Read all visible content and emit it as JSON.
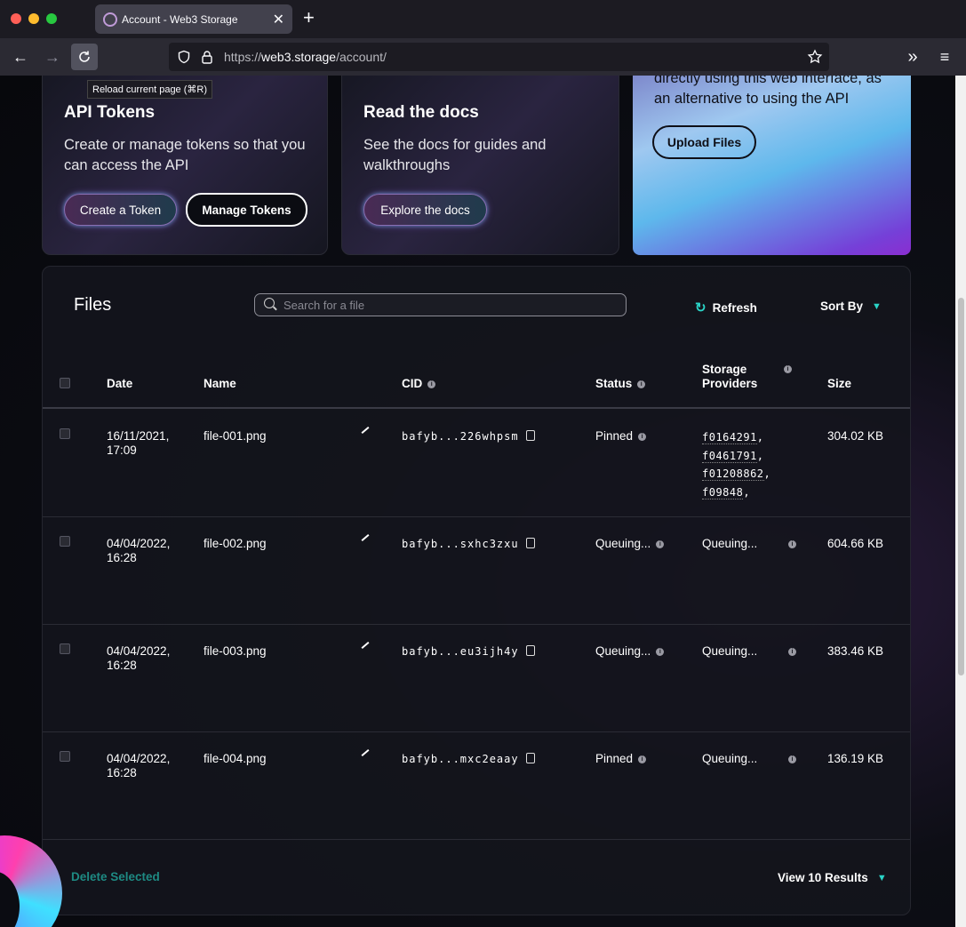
{
  "browser": {
    "tab_title": "Account - Web3 Storage",
    "url_scheme": "https://",
    "url_domain": "web3.storage",
    "url_path": "/account/",
    "reload_tooltip": "Reload current page (⌘R)"
  },
  "cards": {
    "api": {
      "title": "API Tokens",
      "description": "Create or manage tokens so that you can access the API",
      "create_label": "Create a Token",
      "manage_label": "Manage Tokens"
    },
    "docs": {
      "title": "Read the docs",
      "description": "See the docs for guides and walkthroughs",
      "explore_label": "Explore the docs"
    },
    "upload": {
      "description": "directly using this web interface, as an alternative to using the API",
      "upload_label": "Upload Files"
    }
  },
  "files": {
    "title": "Files",
    "search_placeholder": "Search for a file",
    "refresh_label": "Refresh",
    "sort_label": "Sort By",
    "columns": {
      "date": "Date",
      "name": "Name",
      "cid": "CID",
      "status": "Status",
      "storage_providers_1": "Storage",
      "storage_providers_2": "Providers",
      "size": "Size"
    },
    "rows": [
      {
        "date_1": "16/11/2021,",
        "date_2": "17:09",
        "name": "file-001.png",
        "cid": "bafyb...226whpsm",
        "status": "Pinned",
        "providers": [
          "f0164291",
          "f0461791",
          "f01208862",
          "f09848"
        ],
        "size": "304.02 KB"
      },
      {
        "date_1": "04/04/2022,",
        "date_2": "16:28",
        "name": "file-002.png",
        "cid": "bafyb...sxhc3zxu",
        "status": "Queuing...",
        "providers_text": "Queuing...",
        "size": "604.66 KB"
      },
      {
        "date_1": "04/04/2022,",
        "date_2": "16:28",
        "name": "file-003.png",
        "cid": "bafyb...eu3ijh4y",
        "status": "Queuing...",
        "providers_text": "Queuing...",
        "size": "383.46 KB"
      },
      {
        "date_1": "04/04/2022,",
        "date_2": "16:28",
        "name": "file-004.png",
        "cid": "bafyb...mxc2eaay",
        "status": "Pinned",
        "providers_text": "Queuing...",
        "size": "136.19 KB"
      }
    ],
    "delete_label": "Delete Selected",
    "view_results_label": "View 10 Results"
  },
  "colors": {
    "accent": "#2ad4c7",
    "delete": "#1e8a83"
  }
}
